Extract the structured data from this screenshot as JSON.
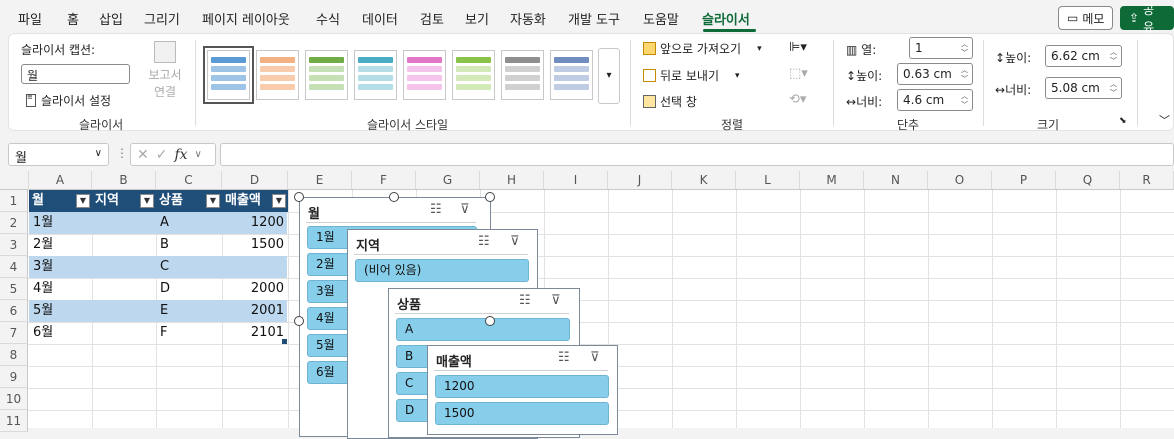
{
  "tabs": [
    "파일",
    "홈",
    "삽입",
    "그리기",
    "페이지 레이아웃",
    "수식",
    "데이터",
    "검토",
    "보기",
    "자동화",
    "개발 도구",
    "도움말",
    "슬라이서"
  ],
  "top_buttons": {
    "memo": "메모",
    "share": "공유"
  },
  "ribbon": {
    "slicer_group": {
      "caption_label": "슬라이서 캡션:",
      "caption_value": "월",
      "settings": "슬라이서 설정",
      "report_conn": "보고서",
      "report_conn2": "연결",
      "group_label": "슬라이서"
    },
    "styles_group": {
      "group_label": "슬라이서 스타일"
    },
    "arrange_group": {
      "bring_forward": "앞으로 가져오기",
      "send_backward": "뒤로 보내기",
      "selection_pane": "선택 창",
      "group_label": "정렬"
    },
    "buttons_group": {
      "columns_label": "열:",
      "columns_value": "1",
      "height_label": "높이:",
      "height_value": "0.63 cm",
      "width_label": "너비:",
      "width_value": "4.6 cm",
      "group_label": "단추"
    },
    "size_group": {
      "height_label": "높이:",
      "height_value": "6.62 cm",
      "width_label": "너비:",
      "width_value": "5.08 cm",
      "group_label": "크기"
    }
  },
  "formula_bar": {
    "name_box": "월",
    "fx": "fx",
    "value": ""
  },
  "columns": [
    "A",
    "B",
    "C",
    "D",
    "E",
    "F",
    "G",
    "H",
    "I",
    "J",
    "K",
    "L",
    "M",
    "N",
    "O",
    "P",
    "Q",
    "R"
  ],
  "rows": [
    "1",
    "2",
    "3",
    "4",
    "5",
    "6",
    "7",
    "8",
    "9",
    "10",
    "11"
  ],
  "table": {
    "headers": [
      "월",
      "지역",
      "상품",
      "매출액"
    ],
    "rows": [
      [
        "1월",
        "",
        "A",
        "1200"
      ],
      [
        "2월",
        "",
        "B",
        "1500"
      ],
      [
        "3월",
        "",
        "C",
        ""
      ],
      [
        "4월",
        "",
        "D",
        "2000"
      ],
      [
        "5월",
        "",
        "E",
        "2001"
      ],
      [
        "6월",
        "",
        "F",
        "2101"
      ]
    ]
  },
  "slicers": {
    "month": {
      "title": "월",
      "items": [
        "1월",
        "2월",
        "3월",
        "4월",
        "5월",
        "6월"
      ]
    },
    "region": {
      "title": "지역",
      "items": [
        "(비어 있음)"
      ]
    },
    "product": {
      "title": "상품",
      "items": [
        "A",
        "B",
        "C",
        "D"
      ]
    },
    "sales": {
      "title": "매출액",
      "items": [
        "1200",
        "1500"
      ]
    }
  },
  "colors": {
    "accent": "#0e6b37",
    "table_header": "#1f4e79",
    "band": "#bdd7ee",
    "slicer_item": "#87ceeb"
  }
}
